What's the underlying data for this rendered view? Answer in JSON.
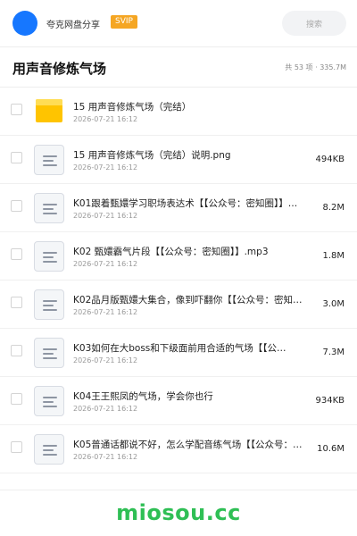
{
  "header": {
    "app_name": "夸克网盘分享",
    "vip_label": "SVIP",
    "search_placeholder": "搜索"
  },
  "folder": {
    "title": "用声音修炼气场",
    "stats": "共 53 项 · 335.7M"
  },
  "files": [
    {
      "name": "15 用声音修炼气场（完结）",
      "date": "2026-07-21 16:12",
      "size": "",
      "icon": "folder-icon"
    },
    {
      "name": "15 用声音修炼气场（完结）说明.png",
      "date": "2026-07-21 16:12",
      "size": "494KB",
      "icon": "document-icon"
    },
    {
      "name": "K01跟着甄嬛学习职场表达术【【公众号：密知圈】】…",
      "date": "2026-07-21 16:12",
      "size": "8.2M",
      "icon": "document-icon"
    },
    {
      "name": "K02 甄嬛霸气片段【【公众号：密知圈】】.mp3",
      "date": "2026-07-21 16:12",
      "size": "1.8M",
      "icon": "document-icon"
    },
    {
      "name": "K02品月版甄嬛大集合，像到吓翻你【【公众号：密知…",
      "date": "2026-07-21 16:12",
      "size": "3.0M",
      "icon": "document-icon"
    },
    {
      "name": "K03如何在大boss和下级面前用合适的气场【【公…",
      "date": "2026-07-21 16:12",
      "size": "7.3M",
      "icon": "document-icon"
    },
    {
      "name": "K04王王熙凤的气场，学会你也行",
      "date": "2026-07-21 16:12",
      "size": "934KB",
      "icon": "document-icon"
    },
    {
      "name": "K05普通话都说不好，怎么学配音练气场【【公众号：…",
      "date": "2026-07-21 16:12",
      "size": "10.6M",
      "icon": "document-icon"
    }
  ],
  "footer": {
    "brand": "miosou.cc"
  }
}
